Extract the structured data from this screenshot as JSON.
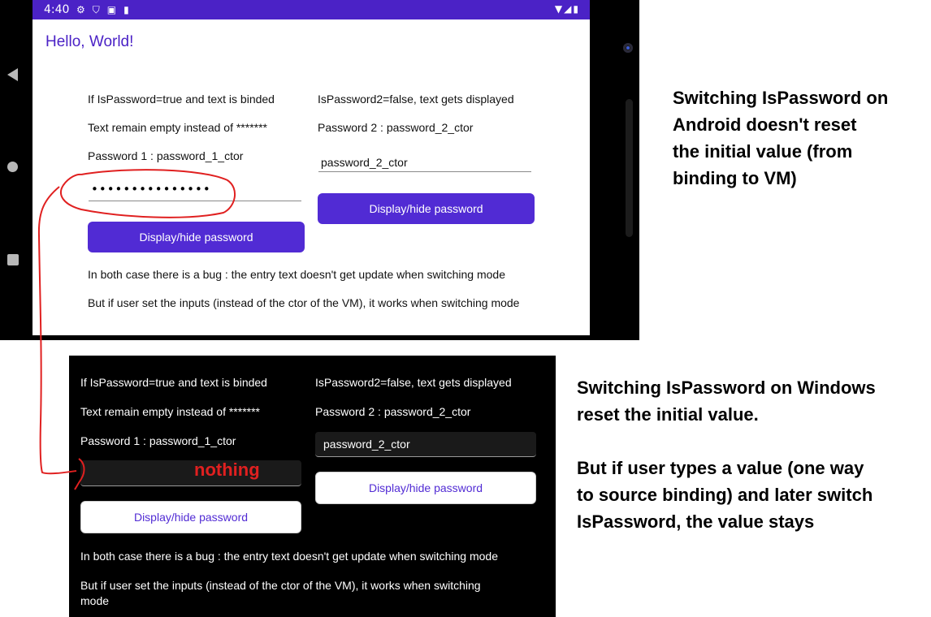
{
  "android": {
    "status_time": "4:40",
    "status_icons_left": [
      "gear-icon",
      "shield-icon",
      "a-icon",
      "sd-card-icon"
    ],
    "status_icons_right": [
      "wifi-icon",
      "signal-icon",
      "battery-icon"
    ],
    "title": "Hello, World!",
    "col1": {
      "line1": "If IsPassword=true and text is binded",
      "line2": "Text remain empty instead of *******",
      "line3": "Password 1 : password_1_ctor",
      "entry_value": "•••••••••••••••",
      "button": "Display/hide password"
    },
    "col2": {
      "line1": "IsPassword2=false, text gets displayed",
      "line2": "Password 2 : password_2_ctor",
      "entry_value": "password_2_ctor",
      "button": "Display/hide password"
    },
    "footer1": "In both case there is a bug : the entry text doesn't get update when switching mode",
    "footer2": "But if user set the inputs (instead of the ctor of the VM), it works when switching mode"
  },
  "windows": {
    "col1": {
      "line1": "If IsPassword=true and text is binded",
      "line2": "Text remain empty instead of *******",
      "line3": "Password 1 : password_1_ctor",
      "entry_value": "",
      "button": "Display/hide password"
    },
    "col2": {
      "line1": "IsPassword2=false, text gets displayed",
      "line2": "Password 2 : password_2_ctor",
      "entry_value": "password_2_ctor",
      "button": "Display/hide password"
    },
    "footer1": "In both case there is a bug : the entry text doesn't get update when switching mode",
    "footer2_line1": "But if user set the inputs (instead of the ctor of the VM), it works when switching",
    "footer2_line2": "mode"
  },
  "annotation": {
    "label": "nothing",
    "color": "#e02020"
  },
  "notes": {
    "android": [
      "Switching IsPassword on",
      "Android doesn't reset",
      "the initial value (from",
      "binding to VM)"
    ],
    "windows": [
      "Switching IsPassword on Windows",
      "reset the initial value."
    ],
    "windows_extra": [
      "But if user types a value (one way",
      "to source binding) and later switch",
      "IsPassword, the value stays"
    ]
  },
  "colors": {
    "accent": "#512bd4",
    "status_bar": "#4b22c6",
    "annotation": "#e02020"
  }
}
